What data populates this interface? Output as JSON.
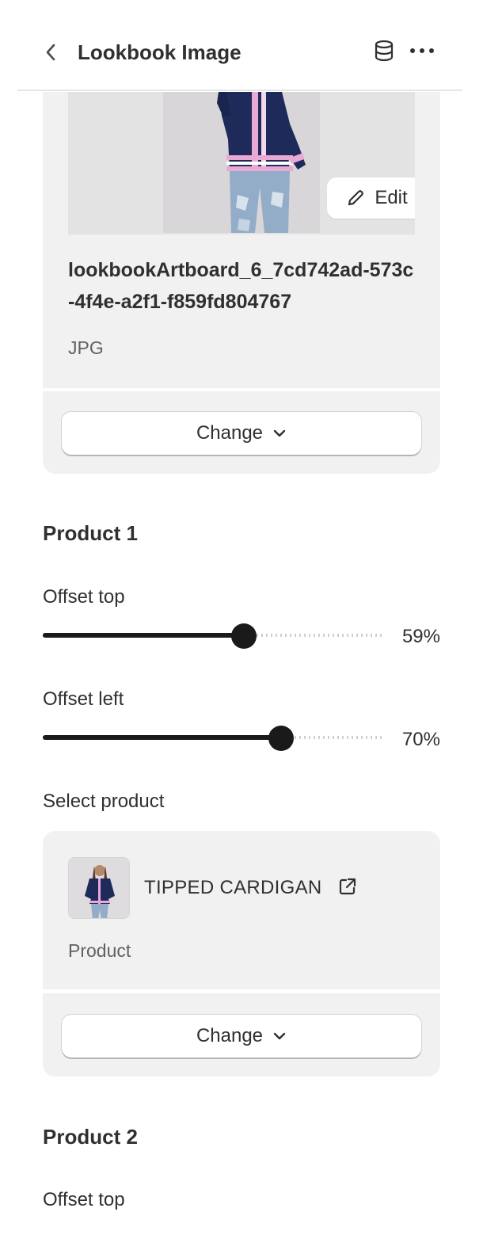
{
  "header": {
    "title": "Lookbook Image",
    "back_icon": "chevron-left-icon",
    "data_source_icon": "database-icon",
    "more_icon": "ellipsis-icon"
  },
  "image_picker": {
    "edit_label": "Edit",
    "filename": "lookbookArtboard_6_7cd742ad-573c-4f4e-a2f1-f859fd804767",
    "filetype": "JPG",
    "change_label": "Change"
  },
  "product1": {
    "title": "Product 1",
    "offset_top": {
      "label": "Offset top",
      "value": 59,
      "value_text": "59%"
    },
    "offset_left": {
      "label": "Offset left",
      "value": 70,
      "value_text": "70%"
    },
    "select_label": "Select product",
    "product": {
      "name": "TIPPED CARDIGAN",
      "type": "Product",
      "change_label": "Change"
    }
  },
  "product2": {
    "title": "Product 2",
    "offset_top": {
      "label": "Offset top"
    }
  },
  "colors": {
    "card_bg": "#f1f1f1",
    "text": "#303030",
    "muted": "#616161",
    "slider_fill": "#1a1a1a",
    "cardigan_navy": "#1e2a5a",
    "trim_pink": "#e8a9d6"
  }
}
